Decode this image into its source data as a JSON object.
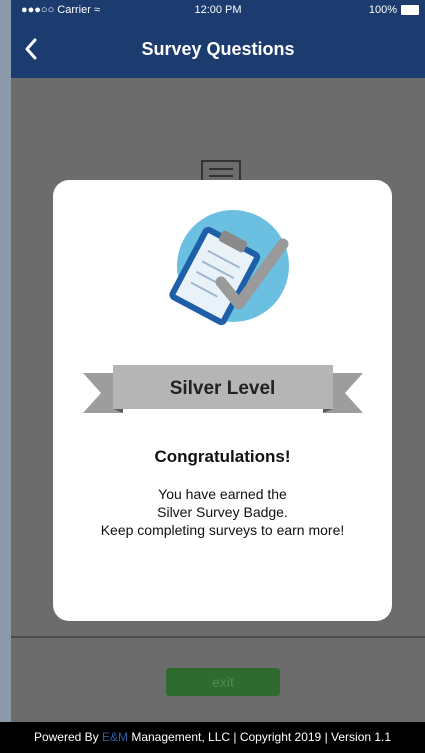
{
  "status_bar": {
    "carrier": "●●●○○ Carrier",
    "time": "12:00 PM",
    "battery": "100%"
  },
  "nav": {
    "title": "Survey Questions"
  },
  "modal": {
    "badge_label": "Silver Level",
    "heading": "Congratulations!",
    "message_lines": [
      "You have earned the",
      "Silver Survey Badge.",
      "Keep completing surveys to earn more!"
    ]
  },
  "exit_button": {
    "label": "exit"
  },
  "footer": {
    "prefix": "Powered By ",
    "brand": "E&M",
    "suffix": " Management, LLC | Copyright 2019 | Version 1.1"
  },
  "colors": {
    "nav_bg": "#1c3b6e",
    "exit_bg": "#2f6b2f",
    "badge_circle": "#6bbfe0",
    "clipboard": "#1f5fa8",
    "ribbon": "#b5b5b5"
  },
  "icons": [
    "back-chevron-icon",
    "wifi-icon",
    "battery-icon",
    "clipboard-check-icon",
    "document-icon"
  ]
}
